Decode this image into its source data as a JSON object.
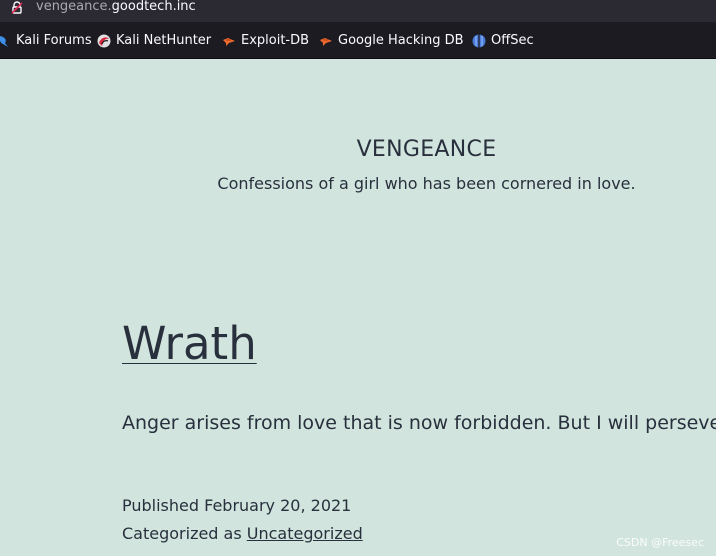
{
  "browser": {
    "url_subdomain": "vengeance.",
    "url_domain": "goodtech.inc",
    "bookmarks": [
      {
        "label": "Kali Forums",
        "icon": "kali-dragon-icon"
      },
      {
        "label": "Kali NetHunter",
        "icon": "nethunter-icon"
      },
      {
        "label": "Exploit-DB",
        "icon": "exploit-db-icon"
      },
      {
        "label": "Google Hacking DB",
        "icon": "ghdb-icon"
      },
      {
        "label": "OffSec",
        "icon": "offsec-icon"
      }
    ]
  },
  "site": {
    "title": "VENGEANCE",
    "description": "Confessions of a girl who has been cornered in love."
  },
  "post": {
    "title": "Wrath",
    "excerpt": "Anger arises from love that is now forbidden. But I will persevere.",
    "published_label": "Published",
    "published_date": "February 20, 2021",
    "categorized_label": "Categorized as",
    "category": "Uncategorized"
  },
  "watermark": "CSDN @Freesec",
  "colors": {
    "page_background": "#d1e4dd",
    "text": "#28303d",
    "toolbar": "#1c1b22",
    "urlbar": "#2b2a33"
  }
}
